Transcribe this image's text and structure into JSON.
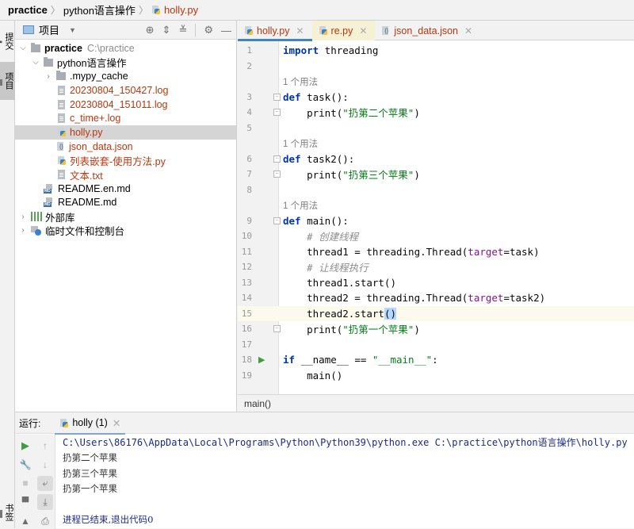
{
  "breadcrumb": {
    "items": [
      "practice",
      "python语言操作",
      "holly.py"
    ],
    "separator": "〉"
  },
  "left_strip": {
    "tabs": [
      {
        "label": "提交",
        "icon": "commit-icon",
        "active": false
      },
      {
        "label": "项目",
        "icon": "folder-icon",
        "active": true
      },
      {
        "label": "书签",
        "icon": "bookmark-icon",
        "active": false
      }
    ]
  },
  "project_panel": {
    "title": "项目",
    "toolbar": [
      "locate-icon",
      "expand-all-icon",
      "collapse-all-icon",
      "gear-icon",
      "minimize-icon"
    ],
    "tree": [
      {
        "label": "practice",
        "suffix": "C:\\practice",
        "type": "folder",
        "expanded": true,
        "level": 0
      },
      {
        "label": "python语言操作",
        "type": "folder",
        "expanded": true,
        "level": 1
      },
      {
        "label": ".mypy_cache",
        "type": "folder",
        "expanded": false,
        "level": 2
      },
      {
        "label": "20230804_150427.log",
        "type": "log",
        "level": 2
      },
      {
        "label": "20230804_151011.log",
        "type": "log",
        "level": 2
      },
      {
        "label": "c_time+.log",
        "type": "log",
        "level": 2
      },
      {
        "label": "holly.py",
        "type": "python",
        "level": 2,
        "selected": true
      },
      {
        "label": "json_data.json",
        "type": "json",
        "level": 2
      },
      {
        "label": "列表嵌套-使用方法.py",
        "type": "python",
        "level": 2
      },
      {
        "label": "文本.txt",
        "type": "text",
        "level": 2
      },
      {
        "label": "README.en.md",
        "type": "markdown",
        "level": 1
      },
      {
        "label": "README.md",
        "type": "markdown",
        "level": 1
      },
      {
        "label": "外部库",
        "type": "library",
        "expanded": false,
        "level": 0
      },
      {
        "label": "临时文件和控制台",
        "type": "scratch",
        "expanded": false,
        "level": 0
      }
    ]
  },
  "editor": {
    "tabs": [
      {
        "label": "holly.py",
        "active": true
      },
      {
        "label": "re.py",
        "active": false
      },
      {
        "label": "json_data.json",
        "active": false
      }
    ],
    "usage_hint": "1 个用法",
    "current_line": 15,
    "lines": [
      {
        "n": "1",
        "html": "<span class='kw'>import</span> threading"
      },
      {
        "n": "2",
        "html": ""
      },
      {
        "hint": true
      },
      {
        "n": "3",
        "html": "<span class='kw'>def</span> task():",
        "fold": "open"
      },
      {
        "n": "4",
        "html": "    print(<span class='str'>\"扔第二个苹果\"</span>)",
        "fold": "end"
      },
      {
        "n": "5",
        "html": ""
      },
      {
        "hint": true
      },
      {
        "n": "6",
        "html": "<span class='kw'>def</span> task2():",
        "fold": "open"
      },
      {
        "n": "7",
        "html": "    print(<span class='str'>\"扔第三个苹果\"</span>)",
        "fold": "end"
      },
      {
        "n": "8",
        "html": ""
      },
      {
        "hint": true
      },
      {
        "n": "9",
        "html": "<span class='kw'>def</span> main():",
        "fold": "open"
      },
      {
        "n": "10",
        "html": "    <span class='cm'># 创建线程</span>"
      },
      {
        "n": "11",
        "html": "    thread1 = threading.Thread(<span class='param'>target</span>=task)"
      },
      {
        "n": "12",
        "html": "    <span class='cm'># 让线程执行</span>"
      },
      {
        "n": "13",
        "html": "    thread1.start()"
      },
      {
        "n": "14",
        "html": "    thread2 = threading.Thread(<span class='param'>target</span>=task2)"
      },
      {
        "n": "15",
        "html": "    thread2.start<span class='hlb'>()</span>",
        "current": true
      },
      {
        "n": "16",
        "html": "    print(<span class='str'>\"扔第一个苹果\"</span>)",
        "fold": "end"
      },
      {
        "n": "17",
        "html": ""
      },
      {
        "n": "18",
        "html": "<span class='kw'>if</span> __name__ == <span class='str'>\"__main__\"</span>:",
        "run": true
      },
      {
        "n": "19",
        "html": "    main()"
      }
    ],
    "footer": "main()"
  },
  "run_panel": {
    "label": "运行:",
    "tab": "holly (1)",
    "console": [
      {
        "text": "C:\\Users\\86176\\AppData\\Local\\Programs\\Python\\Python39\\python.exe C:\\practice\\python语言操作\\holly.py",
        "style": "cmd"
      },
      {
        "text": "扔第二个苹果",
        "style": "out"
      },
      {
        "text": "扔第三个苹果",
        "style": "out"
      },
      {
        "text": "扔第一个苹果",
        "style": "out"
      },
      {
        "text": "",
        "style": "out"
      },
      {
        "text": "进程已结束,退出代码0",
        "style": "exit"
      }
    ],
    "tools_left": [
      "run-icon",
      "wrench-icon",
      "stop-icon",
      "layout-icon",
      "pin-icon"
    ],
    "tools_right": [
      "up-arrow-icon",
      "down-arrow-icon",
      "soft-wrap-icon",
      "scroll-to-end-icon",
      "print-icon"
    ]
  },
  "colors": {
    "keyword": "#0033b3",
    "string": "#067d17",
    "comment": "#8c8c8c",
    "param": "#871094",
    "console_cmd": "#1a2a8c",
    "file_modified": "#b5380e",
    "accent": "#4083c9"
  }
}
